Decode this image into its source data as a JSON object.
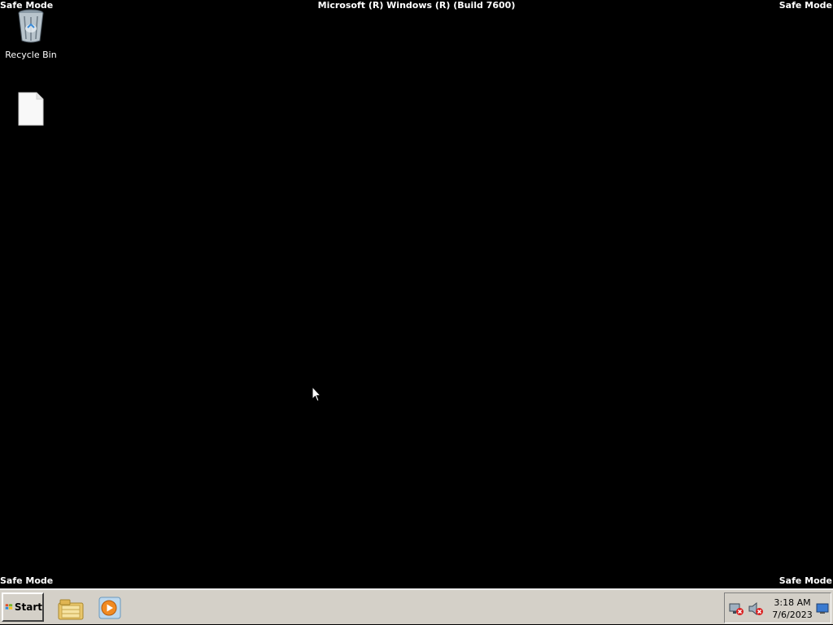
{
  "overlay": {
    "safe_mode_top_left": "Safe Mode",
    "safe_mode_top_right": "Safe Mode",
    "safe_mode_bottom_left": "Safe Mode",
    "safe_mode_bottom_right": "Safe Mode",
    "build_text": "Microsoft (R) Windows (R) (Build 7600)"
  },
  "desktop": {
    "icons": [
      {
        "label": "Recycle Bin",
        "icon": "recycle-bin-icon"
      },
      {
        "label": "",
        "icon": "file-icon"
      }
    ]
  },
  "taskbar": {
    "start_label": "Start",
    "pinned": [
      {
        "icon": "windows-explorer-icon"
      },
      {
        "icon": "media-player-icon"
      }
    ],
    "tray": {
      "network_icon": "network-disconnected-icon",
      "volume_icon": "volume-muted-icon",
      "time": "3:18 AM",
      "date": "7/6/2023"
    }
  },
  "colors": {
    "desktop_bg": "#000000",
    "taskbar_bg": "#d4d0c8"
  }
}
